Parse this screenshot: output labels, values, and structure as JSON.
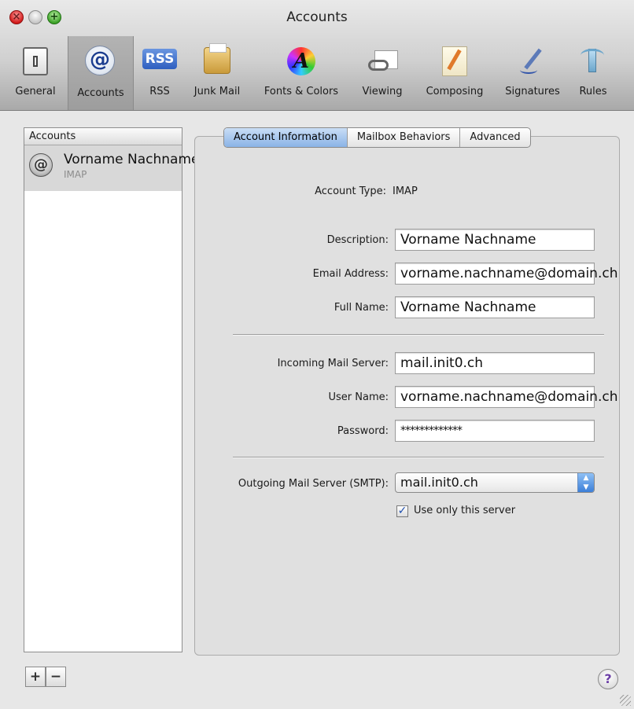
{
  "window": {
    "title": "Accounts"
  },
  "toolbar": {
    "items": [
      {
        "label": "General",
        "icon": "switch-icon"
      },
      {
        "label": "Accounts",
        "icon": "at-icon",
        "selected": true
      },
      {
        "label": "RSS",
        "icon": "rss-icon"
      },
      {
        "label": "Junk Mail",
        "icon": "junk-mail-icon"
      },
      {
        "label": "Fonts & Colors",
        "icon": "fonts-colors-icon"
      },
      {
        "label": "Viewing",
        "icon": "viewing-glasses-icon"
      },
      {
        "label": "Composing",
        "icon": "composing-pencil-icon"
      },
      {
        "label": "Signatures",
        "icon": "signature-pen-icon"
      },
      {
        "label": "Rules",
        "icon": "rules-arrow-icon"
      }
    ],
    "rss_badge": "RSS"
  },
  "sidebar": {
    "header": "Accounts",
    "accounts": [
      {
        "name": "Vorname Nachname",
        "type": "IMAP"
      }
    ],
    "add_label": "+",
    "remove_label": "−"
  },
  "tabs": [
    {
      "label": "Account Information",
      "active": true
    },
    {
      "label": "Mailbox Behaviors",
      "active": false
    },
    {
      "label": "Advanced",
      "active": false
    }
  ],
  "form": {
    "account_type_label": "Account Type:",
    "account_type_value": "IMAP",
    "description_label": "Description:",
    "description_value": "Vorname Nachname",
    "email_label": "Email Address:",
    "email_value": "vorname.nachname@domain.ch",
    "full_name_label": "Full Name:",
    "full_name_value": "Vorname Nachname",
    "incoming_label": "Incoming Mail Server:",
    "incoming_value": "mail.init0.ch",
    "username_label": "User Name:",
    "username_value": "vorname.nachname@domain.ch",
    "password_label": "Password:",
    "password_value": "*************",
    "outgoing_label": "Outgoing Mail Server (SMTP):",
    "outgoing_value": "mail.init0.ch",
    "use_only_label": "Use only this server",
    "use_only_checked": true
  },
  "help_label": "?"
}
